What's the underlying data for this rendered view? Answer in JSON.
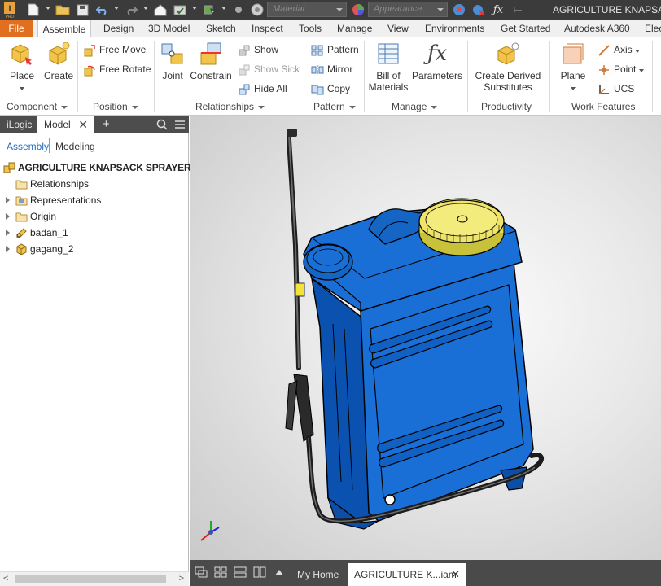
{
  "titlebar": {
    "app_title": "AGRICULTURE KNAPSACK",
    "material_placeholder": "Material",
    "appearance_placeholder": "Appearance"
  },
  "ribbon_tabs": [
    "File",
    "Assemble",
    "Design",
    "3D Model",
    "Sketch",
    "Inspect",
    "Tools",
    "Manage",
    "View",
    "Environments",
    "Get Started",
    "Autodesk A360",
    "Elec"
  ],
  "ribbon": {
    "place": "Place",
    "create": "Create",
    "free_move": "Free Move",
    "free_rotate": "Free Rotate",
    "joint": "Joint",
    "constrain": "Constrain",
    "show": "Show",
    "show_sick": "Show Sick",
    "hide_all": "Hide All",
    "pattern": "Pattern",
    "mirror": "Mirror",
    "copy": "Copy",
    "bill_of_materials_1": "Bill of",
    "bill_of_materials_2": "Materials",
    "parameters": "Parameters",
    "create_derived_1": "Create Derived",
    "create_derived_2": "Substitutes",
    "plane": "Plane",
    "axis": "Axis",
    "point": "Point",
    "ucs": "UCS"
  },
  "ribbon_groups": {
    "component": "Component",
    "position": "Position",
    "relationships": "Relationships",
    "pattern": "Pattern",
    "manage": "Manage",
    "productivity": "Productivity",
    "work_features": "Work Features"
  },
  "browser": {
    "tab_ilogic": "iLogic",
    "tab_model": "Model",
    "add_tab": "+",
    "subtab_assembly": "Assembly",
    "subtab_modeling": "Modeling",
    "root": "AGRICULTURE KNAPSACK SPRAYER.ia",
    "items": [
      "Relationships",
      "Representations",
      "Origin",
      "badan_1",
      "gagang_2"
    ]
  },
  "doc_tabs": {
    "home": "My Home",
    "active": "AGRICULTURE K...iam"
  },
  "colors": {
    "file_tab": "#e0701f",
    "tank_blue": "#1a6fd6",
    "cap_yellow": "#efe36a"
  }
}
